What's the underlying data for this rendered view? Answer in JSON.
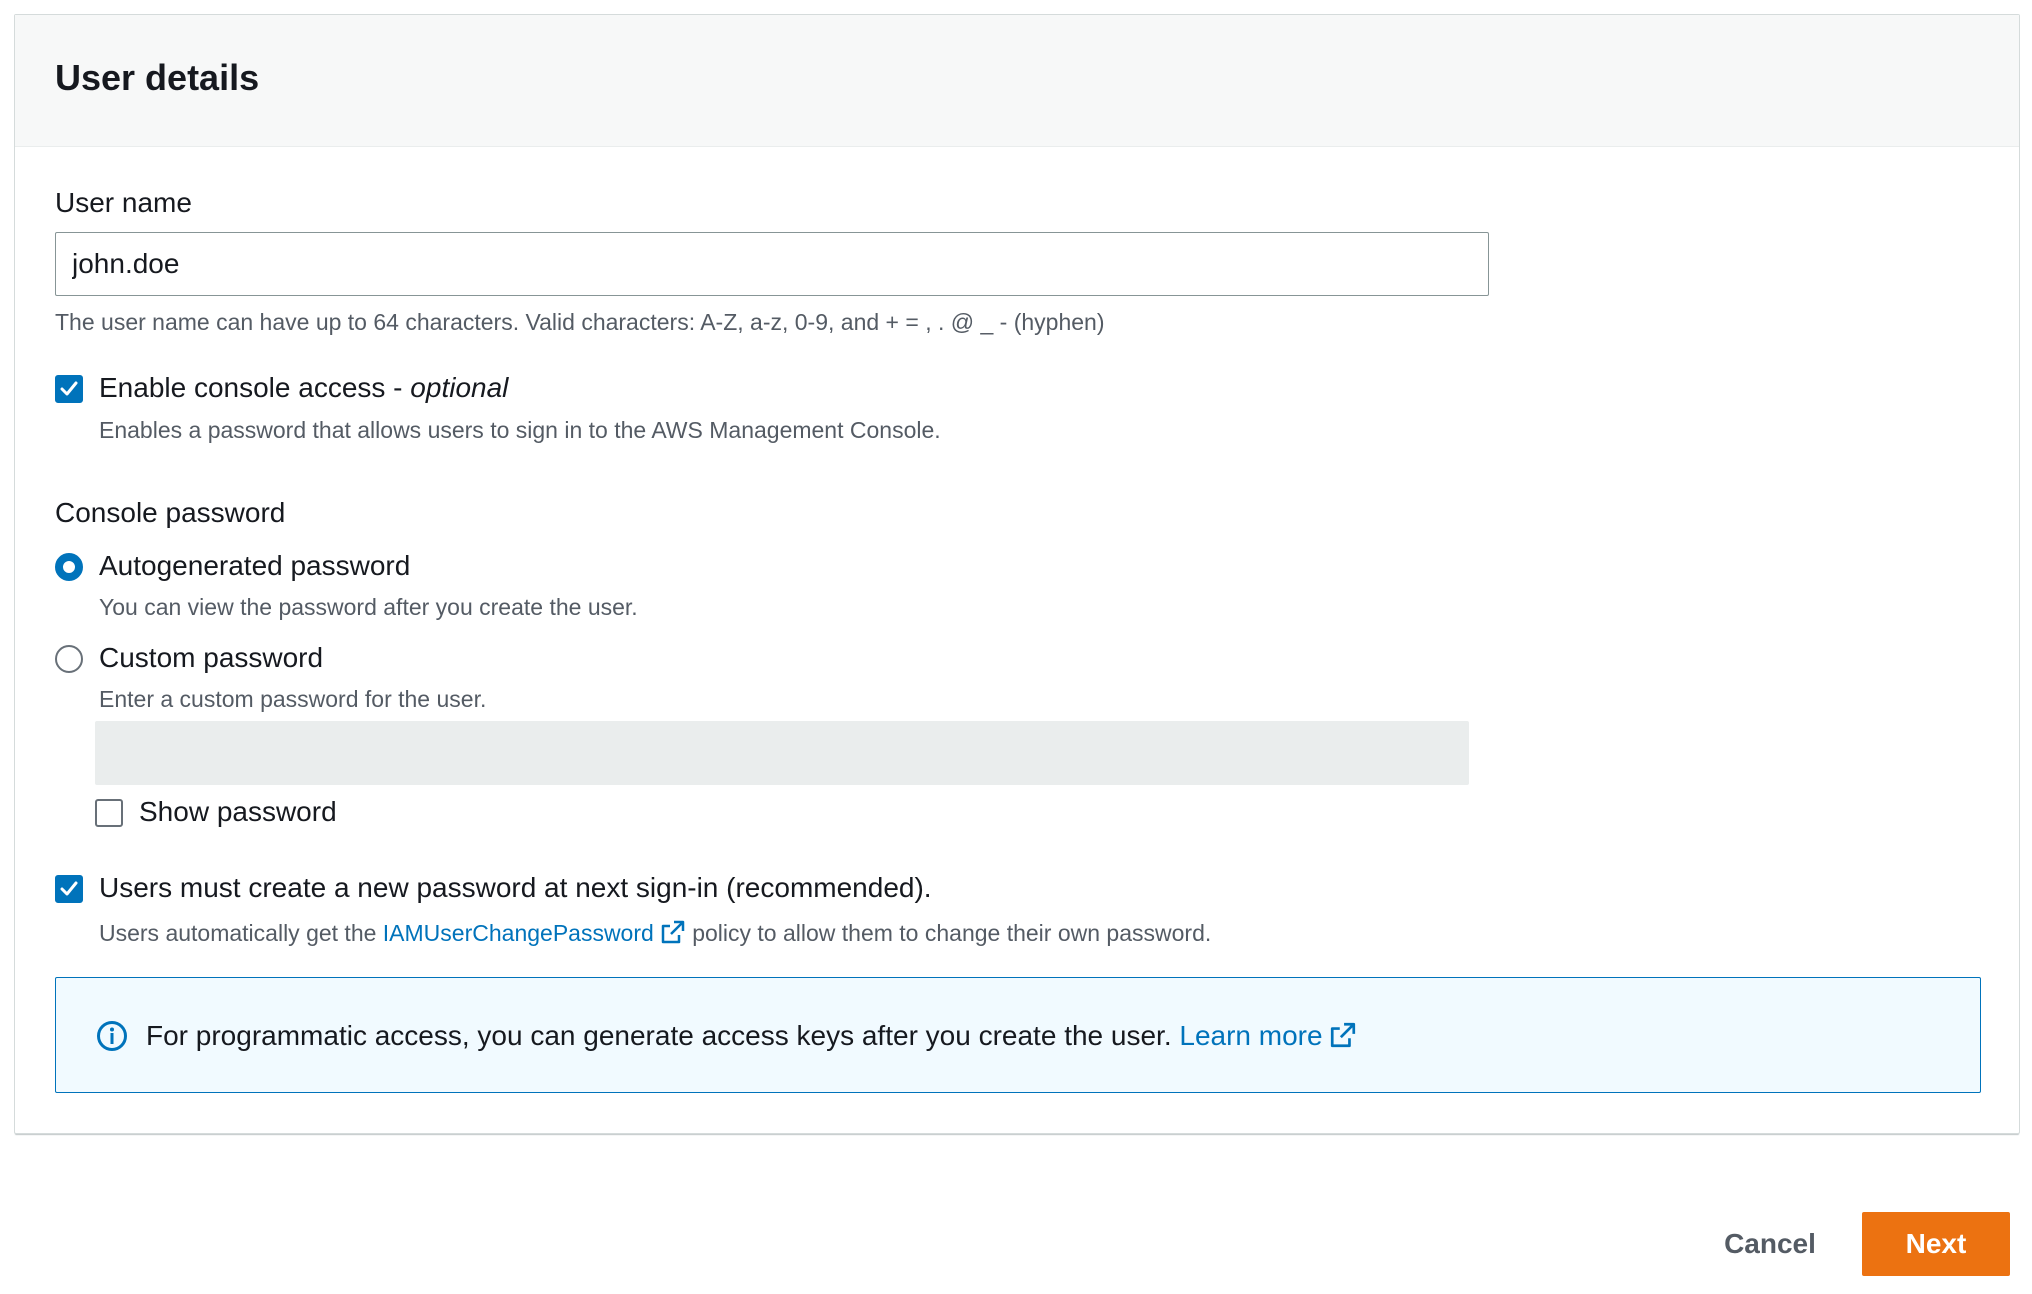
{
  "panel": {
    "title": "User details"
  },
  "user_name": {
    "label": "User name",
    "value": "john.doe",
    "constraint": "The user name can have up to 64 characters. Valid characters: A-Z, a-z, 0-9, and + = , . @ _ - (hyphen)"
  },
  "console_access": {
    "label": "Enable console access -",
    "optional": "optional",
    "description": "Enables a password that allows users to sign in to the AWS Management Console.",
    "checked": true
  },
  "console_password": {
    "label": "Console password",
    "options": [
      {
        "label": "Autogenerated password",
        "description": "You can view the password after you create the user.",
        "selected": true
      },
      {
        "label": "Custom password",
        "description": "Enter a custom password for the user.",
        "selected": false
      }
    ],
    "custom_value": "",
    "show_password_label": "Show password",
    "show_password_checked": false
  },
  "reset_password": {
    "label": "Users must create a new password at next sign-in (recommended).",
    "checked": true,
    "description_before": "Users automatically get the",
    "link_text": "IAMUserChangePassword",
    "description_after": "policy to allow them to change their own password."
  },
  "info": {
    "text": "For programmatic access, you can generate access keys after you create the user.",
    "link_text": "Learn more"
  },
  "actions": {
    "cancel_label": "Cancel",
    "next_label": "Next"
  },
  "colors": {
    "primary_button": "#ec7211",
    "accent": "#0073bb",
    "info_background": "#f1faff"
  }
}
